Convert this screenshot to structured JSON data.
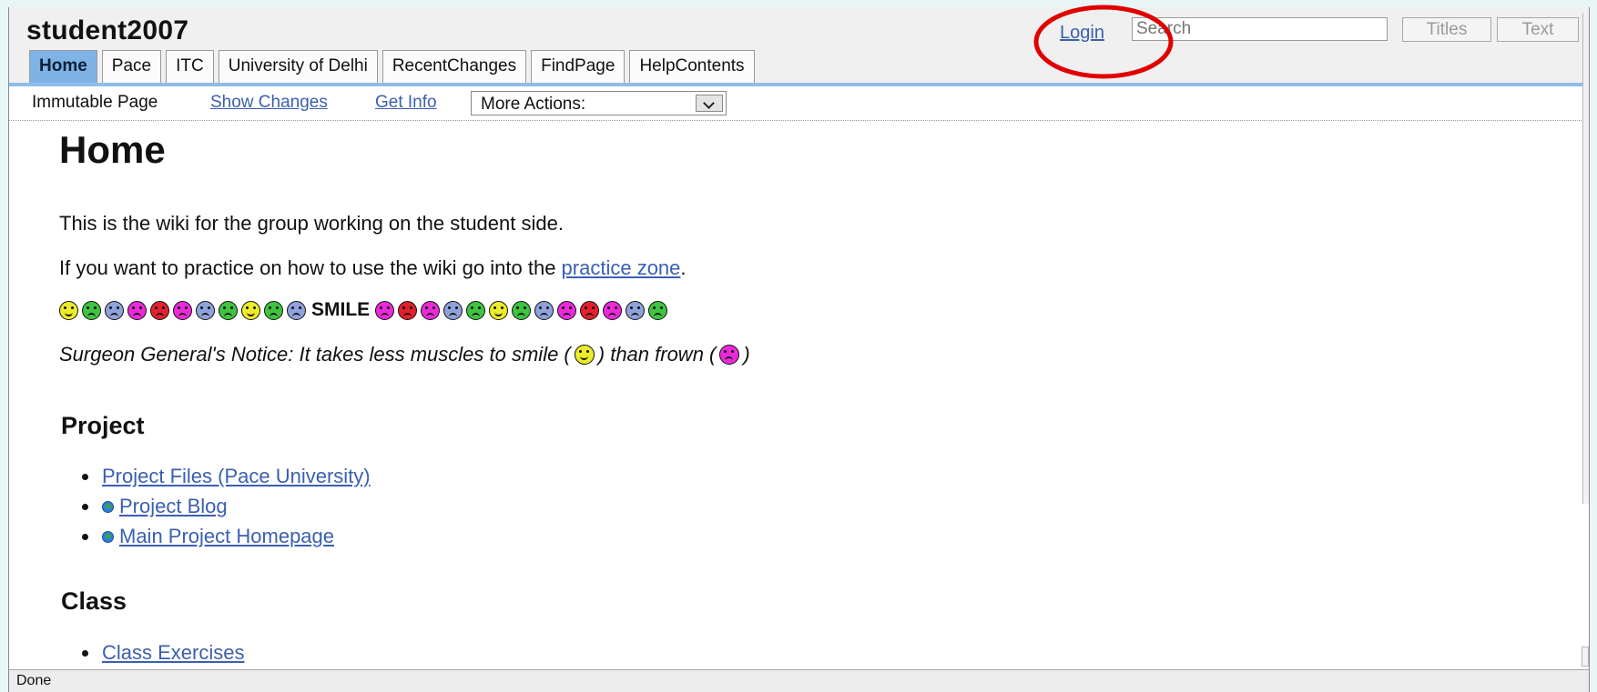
{
  "header": {
    "site_name": "student2007",
    "login_label": "Login",
    "search_placeholder": "Search",
    "titles_button": "Titles",
    "text_button": "Text"
  },
  "tabs": [
    {
      "label": "Home",
      "active": true
    },
    {
      "label": "Pace",
      "active": false
    },
    {
      "label": "ITC",
      "active": false
    },
    {
      "label": "University of Delhi",
      "active": false
    },
    {
      "label": "RecentChanges",
      "active": false
    },
    {
      "label": "FindPage",
      "active": false
    },
    {
      "label": "HelpContents",
      "active": false
    }
  ],
  "actions": {
    "immutable_label": "Immutable Page",
    "show_changes": "Show Changes",
    "get_info": "Get Info",
    "more_actions": "More Actions:"
  },
  "content": {
    "title": "Home",
    "intro": "This is the wiki for the group working on the student side.",
    "practice_prefix": "If you want to practice on how to use the wiki go into the ",
    "practice_link": "practice zone",
    "practice_suffix": ".",
    "smiley_row_word": "SMILE",
    "notice_part1": "Surgeon General's Notice: It takes less muscles to smile (",
    "notice_part2": ") than frown (",
    "notice_part3": ")",
    "project_heading": "Project",
    "project_links": [
      {
        "label": "Project Files (Pace University)",
        "icon": null
      },
      {
        "label": "Project Blog",
        "icon": "globe-icon"
      },
      {
        "label": "Main Project Homepage",
        "icon": "globe-icon"
      }
    ],
    "class_heading": "Class",
    "class_links": [
      {
        "label": "Class Exercises"
      }
    ]
  },
  "smileys_before": [
    {
      "color": "#ecec2a",
      "mood": "happy"
    },
    {
      "color": "#3fc43f",
      "mood": "devil"
    },
    {
      "color": "#8fa2dc",
      "mood": "sad"
    },
    {
      "color": "#ea2ad9",
      "mood": "sad"
    },
    {
      "color": "#e2202e",
      "mood": "angry"
    },
    {
      "color": "#ea2ad9",
      "mood": "sad"
    },
    {
      "color": "#8fa2dc",
      "mood": "sad"
    },
    {
      "color": "#3fc43f",
      "mood": "devil"
    },
    {
      "color": "#ecec2a",
      "mood": "happy"
    },
    {
      "color": "#3fc43f",
      "mood": "devil"
    },
    {
      "color": "#8fa2dc",
      "mood": "sad"
    }
  ],
  "smileys_after": [
    {
      "color": "#ea2ad9",
      "mood": "sad"
    },
    {
      "color": "#e2202e",
      "mood": "angry"
    },
    {
      "color": "#ea2ad9",
      "mood": "sad"
    },
    {
      "color": "#8fa2dc",
      "mood": "sad"
    },
    {
      "color": "#3fc43f",
      "mood": "devil"
    },
    {
      "color": "#ecec2a",
      "mood": "happy"
    },
    {
      "color": "#3fc43f",
      "mood": "devil"
    },
    {
      "color": "#8fa2dc",
      "mood": "sad"
    },
    {
      "color": "#ea2ad9",
      "mood": "sad"
    },
    {
      "color": "#e2202e",
      "mood": "angry"
    },
    {
      "color": "#ea2ad9",
      "mood": "sad"
    },
    {
      "color": "#8fa2dc",
      "mood": "sad"
    },
    {
      "color": "#3fc43f",
      "mood": "devil"
    }
  ],
  "notice_smile_color": "#ecec2a",
  "notice_frown_color": "#ea2ad9",
  "status_text": "Done",
  "colors": {
    "link": "#3b5fb0",
    "active_tab": "#7fb2e5",
    "annotation": "#e00000"
  }
}
